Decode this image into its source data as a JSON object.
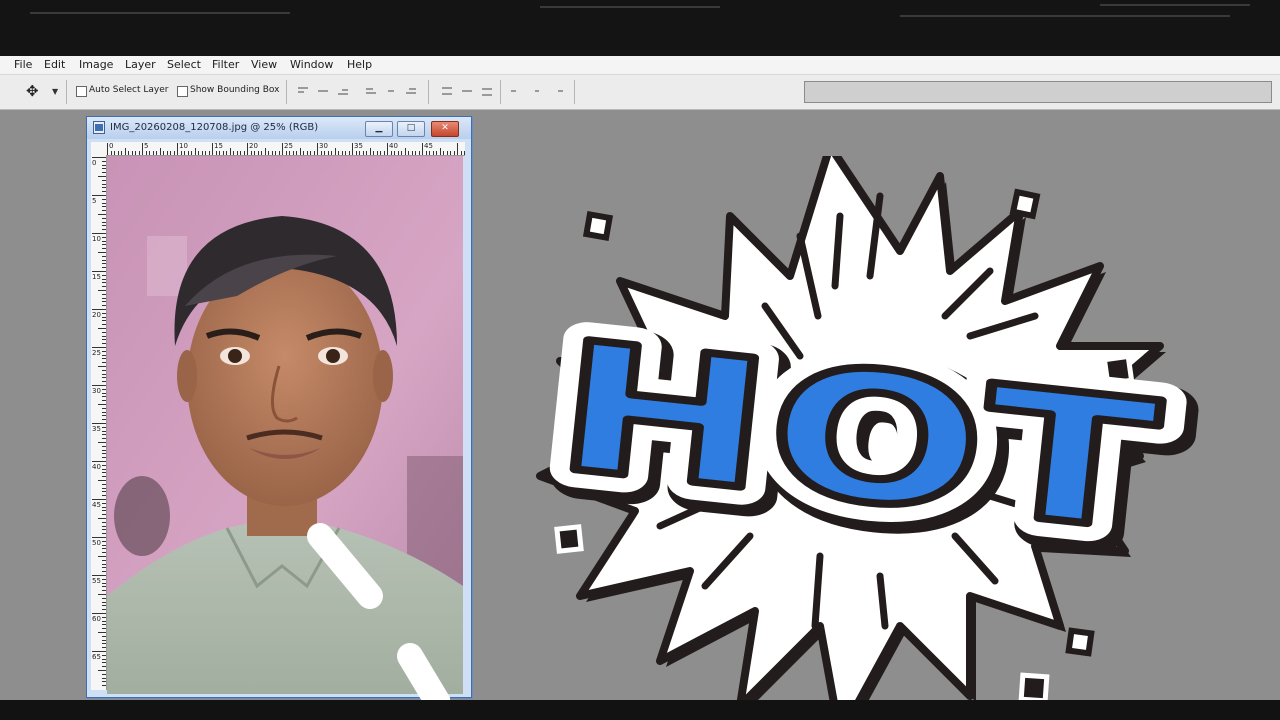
{
  "menu": [
    "File",
    "Edit",
    "Image",
    "Layer",
    "Select",
    "Filter",
    "View",
    "Window",
    "Help"
  ],
  "options_bar": {
    "auto_select_label": "Auto Select Layer",
    "bounding_box_label": "Show Bounding Box"
  },
  "document": {
    "title": "IMG_20260208_120708.jpg @ 25% (RGB)",
    "zoom": "25%",
    "ruler_h": [
      "0",
      "5",
      "10",
      "15",
      "20",
      "25",
      "30",
      "35",
      "40",
      "45"
    ],
    "ruler_v": [
      "0",
      "5",
      "10",
      "15",
      "20",
      "25",
      "30",
      "35",
      "40",
      "45",
      "50",
      "55",
      "60",
      "65"
    ]
  },
  "sticker": {
    "text": "HOT",
    "fill_color": "#2f7de0",
    "outline_color": "#231c1c",
    "burst_color": "#ffffff"
  }
}
